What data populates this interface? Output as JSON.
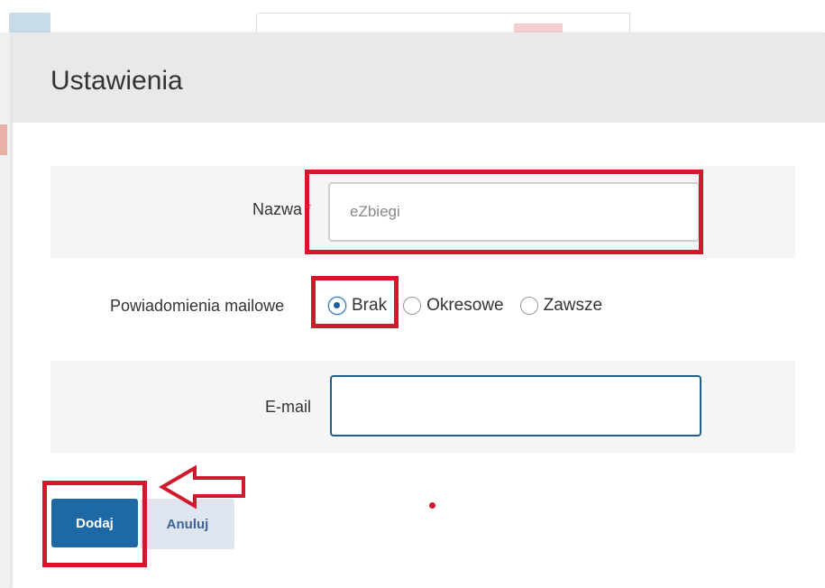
{
  "dialog": {
    "title": "Ustawienia"
  },
  "form": {
    "name": {
      "label": "Nazwa",
      "required_mark": "*",
      "placeholder": "eZbiegi",
      "value": ""
    },
    "notifications": {
      "label": "Powiadomienia mailowe",
      "options": [
        {
          "label": "Brak",
          "checked": true
        },
        {
          "label": "Okresowe",
          "checked": false
        },
        {
          "label": "Zawsze",
          "checked": false
        }
      ]
    },
    "email": {
      "label": "E-mail",
      "value": "",
      "placeholder": ""
    }
  },
  "buttons": {
    "add_label": "Dodaj",
    "cancel_label": "Anuluj"
  },
  "colors": {
    "primary": "#1f68a6",
    "highlight": "#d1192d",
    "header_bg": "#e9e9e9",
    "row_shade": "#f5f5f5"
  }
}
